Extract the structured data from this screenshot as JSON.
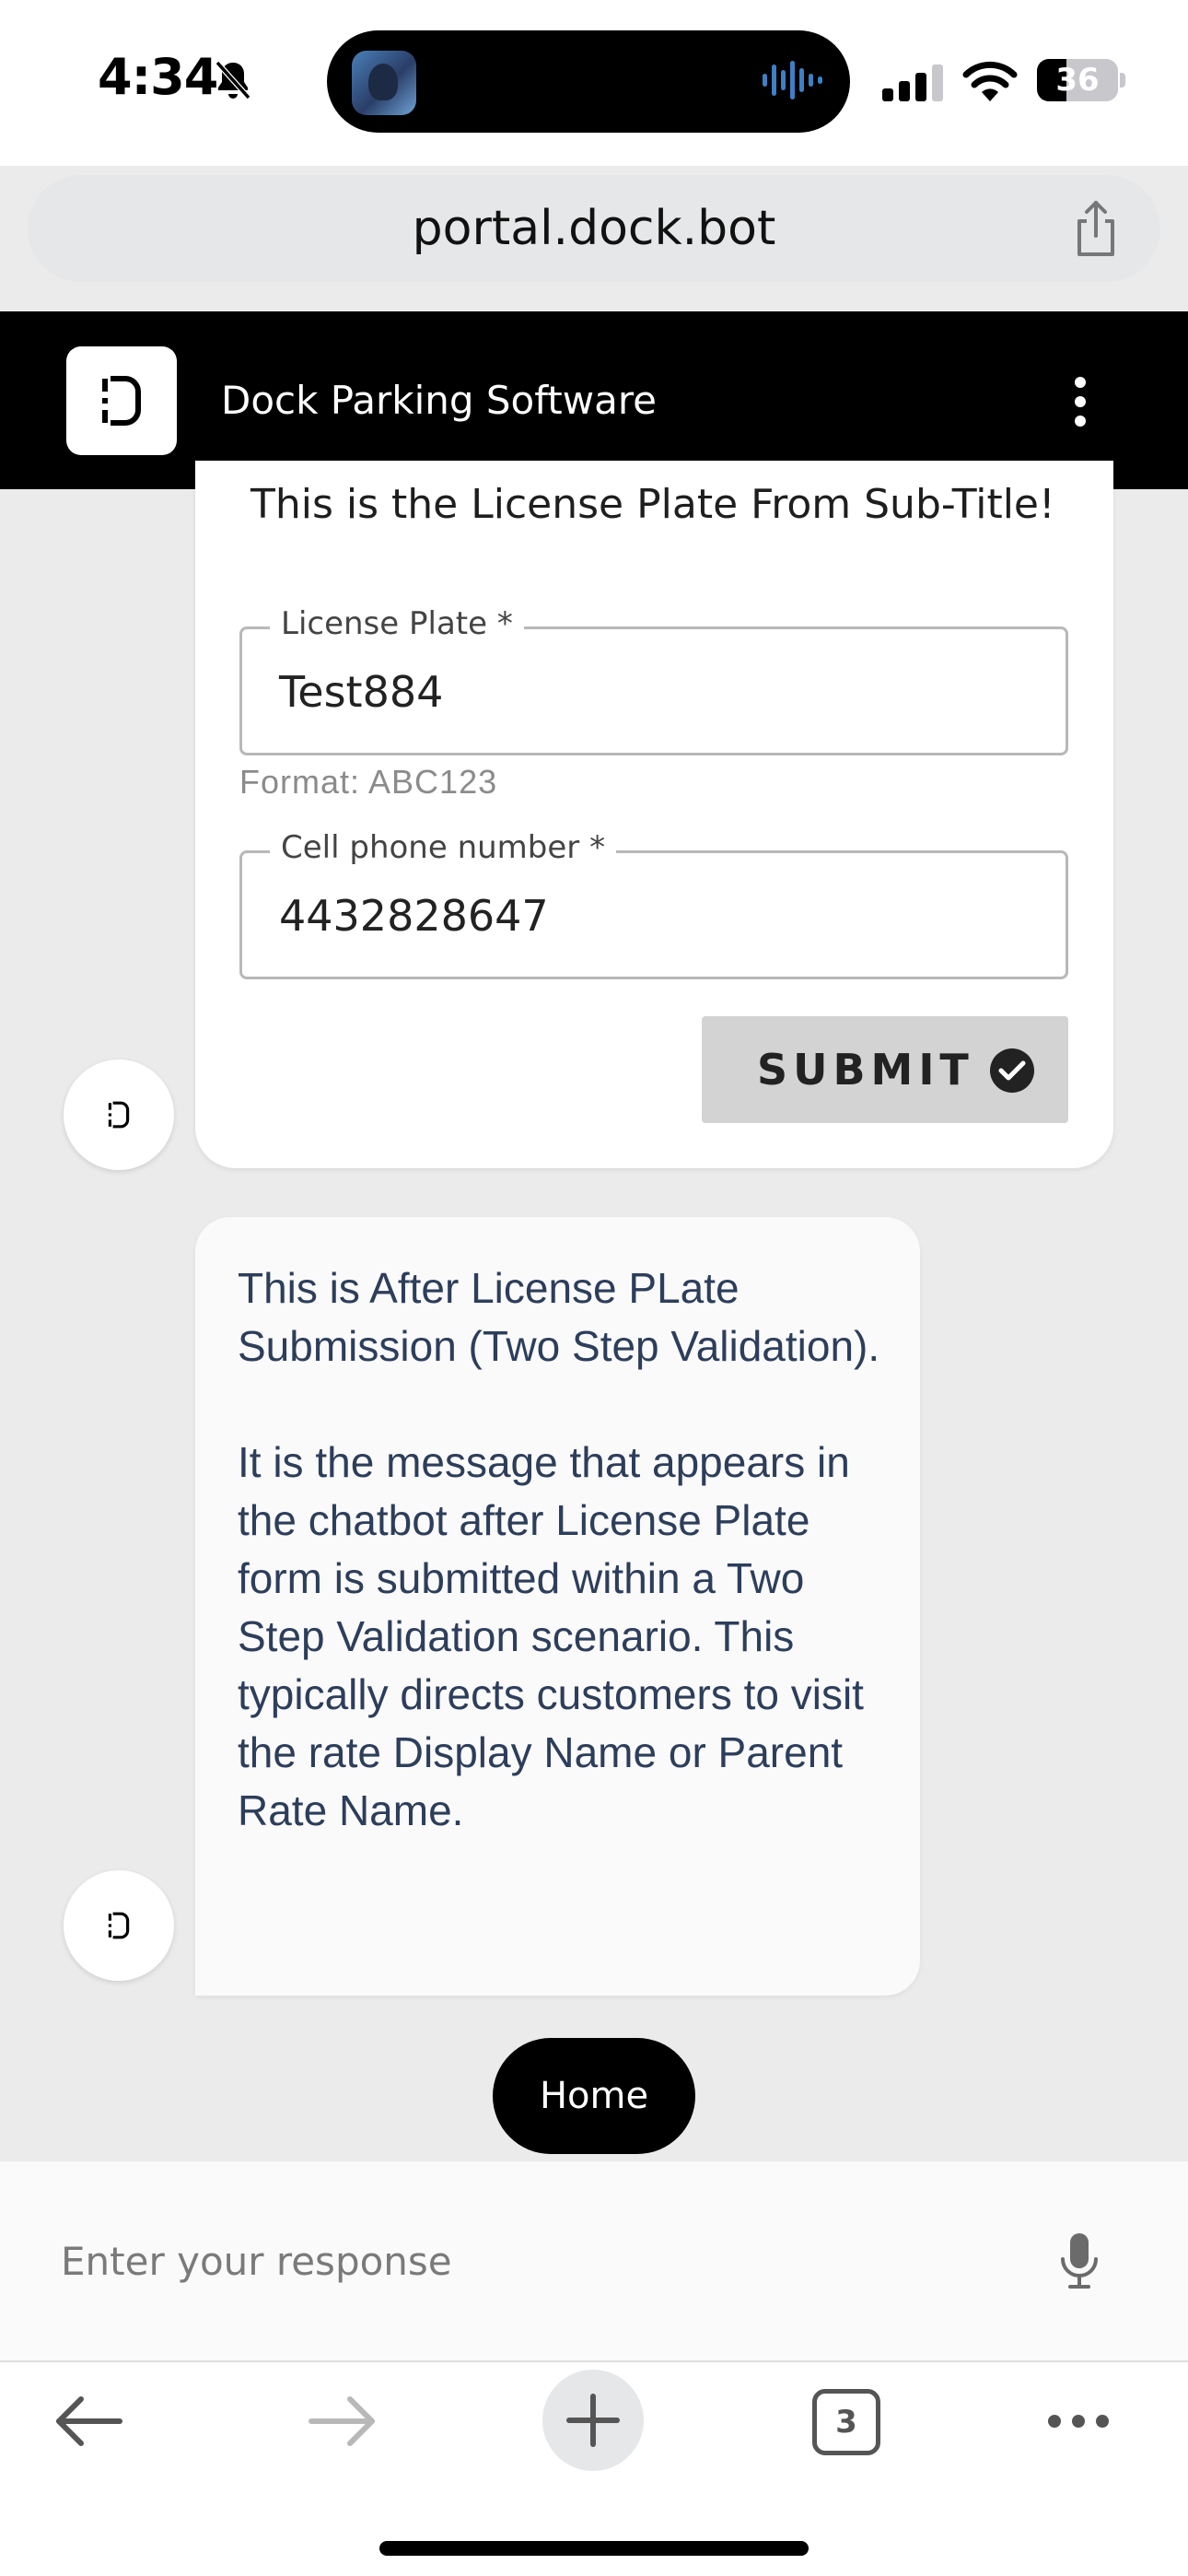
{
  "status_bar": {
    "time": "4:34",
    "battery": "36",
    "battery_level": 0.36
  },
  "browser": {
    "url": "portal.dock.bot",
    "tab_count": "3"
  },
  "app": {
    "title": "Dock Parking Software"
  },
  "form": {
    "subtitle": "This is the License Plate From Sub-Title!",
    "license_plate": {
      "label": "License Plate *",
      "value": "Test884",
      "hint": "Format: ABC123"
    },
    "cell_phone": {
      "label": "Cell phone number *",
      "value": "4432828647"
    },
    "submit_label": "SUBMIT"
  },
  "message": {
    "paragraph_1": "This is After License PLate Submission (Two Step Validation).",
    "paragraph_2": "It is the message that appears in the chatbot after License Plate form is submitted within a Two Step Validation scenario. This typically directs customers to visit the rate Display Name or Parent Rate Name."
  },
  "quick_reply": {
    "home_label": "Home"
  },
  "composer": {
    "placeholder": "Enter your response"
  },
  "icons": {
    "status": [
      "bell-off-icon",
      "waveform-icon",
      "signal-icon",
      "wifi-icon",
      "battery-icon"
    ],
    "browser": [
      "share-icon",
      "back-arrow-icon",
      "forward-arrow-icon",
      "plus-icon",
      "tabs-icon",
      "more-icon"
    ],
    "app": [
      "dock-logo-icon",
      "kebab-menu-icon",
      "check-circle-icon",
      "mic-icon"
    ]
  },
  "colors": {
    "header_bg": "#000000",
    "chat_bg": "#ebebeb",
    "message_text": "#2d3e5b",
    "submit_bg": "#d3d3d3"
  }
}
